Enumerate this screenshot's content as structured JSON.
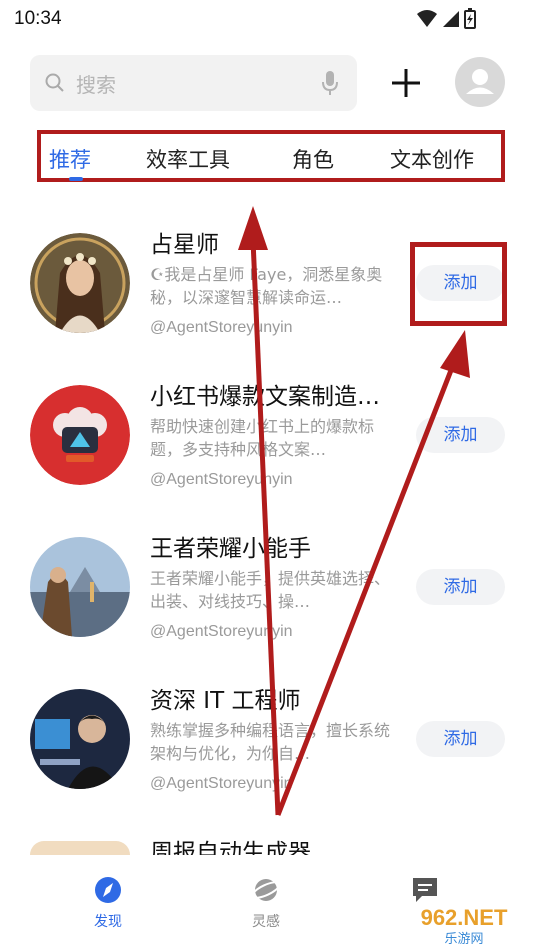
{
  "status": {
    "time": "10:34"
  },
  "search": {
    "placeholder": "搜索"
  },
  "tabs": [
    {
      "label": "推荐",
      "active": true
    },
    {
      "label": "效率工具"
    },
    {
      "label": "角色"
    },
    {
      "label": "文本创作"
    }
  ],
  "agents": [
    {
      "name": "占星师",
      "desc": "☪我是占星师 Faye，洞悉星象奥秘，以深邃智慧解读命运…",
      "handle": "@AgentStoreyunyin",
      "button": "添加"
    },
    {
      "name": "小红书爆款文案制造…",
      "desc": "帮助快速创建小红书上的爆款标题，多支持种风格文案…",
      "handle": "@AgentStoreyunyin",
      "button": "添加"
    },
    {
      "name": "王者荣耀小能手",
      "desc": "王者荣耀小能手，提供英雄选择、出装、对线技巧、操…",
      "handle": "@AgentStoreyunyin",
      "button": "添加"
    },
    {
      "name": "资深 IT 工程师",
      "desc": "熟练掌握多种编程语言，擅长系统架构与优化，为你自…",
      "handle": "@AgentStoreyunyin",
      "button": "添加"
    },
    {
      "name": "周报自动生成器"
    }
  ],
  "bottom_nav": [
    {
      "label": "发现",
      "icon": "compass-icon",
      "active": true
    },
    {
      "label": "灵感",
      "icon": "planet-icon"
    },
    {
      "label": "",
      "icon": "chat-icon"
    }
  ],
  "watermark": {
    "text": "962.NET",
    "sub": "乐游网"
  },
  "colors": {
    "accent": "#2f6ae5",
    "annotation": "#b01c1c"
  }
}
